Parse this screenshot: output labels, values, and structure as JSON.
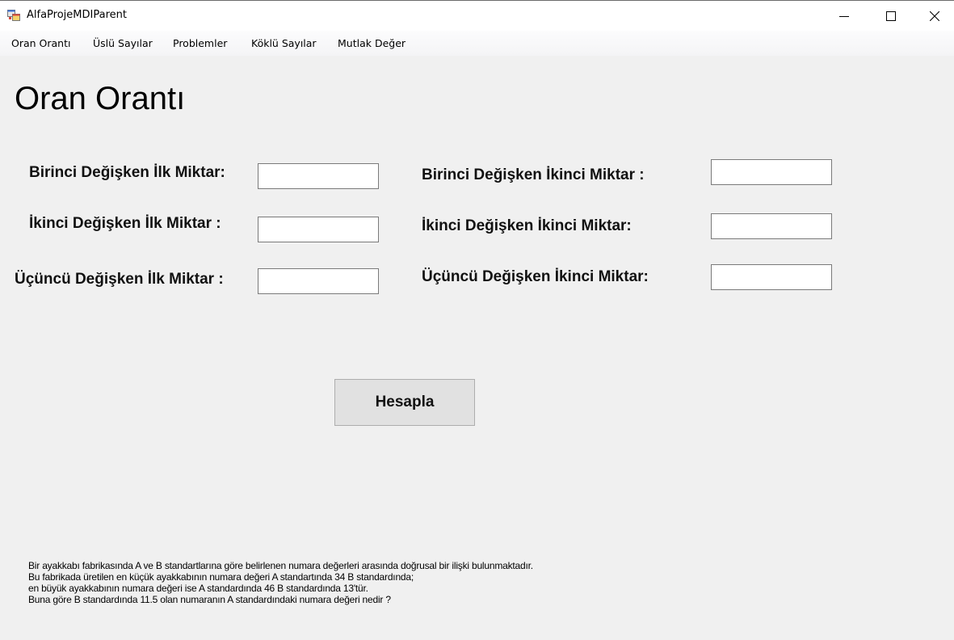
{
  "window": {
    "title": "AlfaProjeMDIParent",
    "icon": "mdi-form-icon"
  },
  "menu": {
    "items": [
      {
        "label": "Oran Orantı"
      },
      {
        "label": "Üslü Sayılar"
      },
      {
        "label": "Problemler"
      },
      {
        "label": "Köklü Sayılar"
      },
      {
        "label": "Mutlak Değer"
      }
    ]
  },
  "form": {
    "title": "Oran Orantı",
    "fields": {
      "first_var_first": {
        "label": "Birinci Değişken İlk  Miktar:",
        "value": ""
      },
      "second_var_first": {
        "label": "İkinci Değişken İlk Miktar :",
        "value": ""
      },
      "third_var_first": {
        "label": "Üçüncü Değişken İlk Miktar :",
        "value": ""
      },
      "first_var_second": {
        "label": "Birinci Değişken İkinci Miktar  :",
        "value": ""
      },
      "second_var_second": {
        "label": "İkinci Değişken İkinci Miktar:",
        "value": ""
      },
      "third_var_second": {
        "label": "Üçüncü Değişken İkinci Miktar:",
        "value": ""
      }
    },
    "calculate_label": "Hesapla",
    "problem_lines": [
      "Bir ayakkabı fabrikasında A ve B standartlarına göre belirlenen numara değerleri arasında doğrusal bir ilişki bulunmaktadır.",
      "Bu fabrikada üretilen en küçük ayakkabının numara değeri A standartında 34 B standardında;",
      "en büyük ayakkabının numara değeri ise A standardında 46 B standardında 13'tür.",
      "Buna göre B standardında 11.5 olan numaranın A standardındaki numara değeri nedir ?"
    ]
  }
}
